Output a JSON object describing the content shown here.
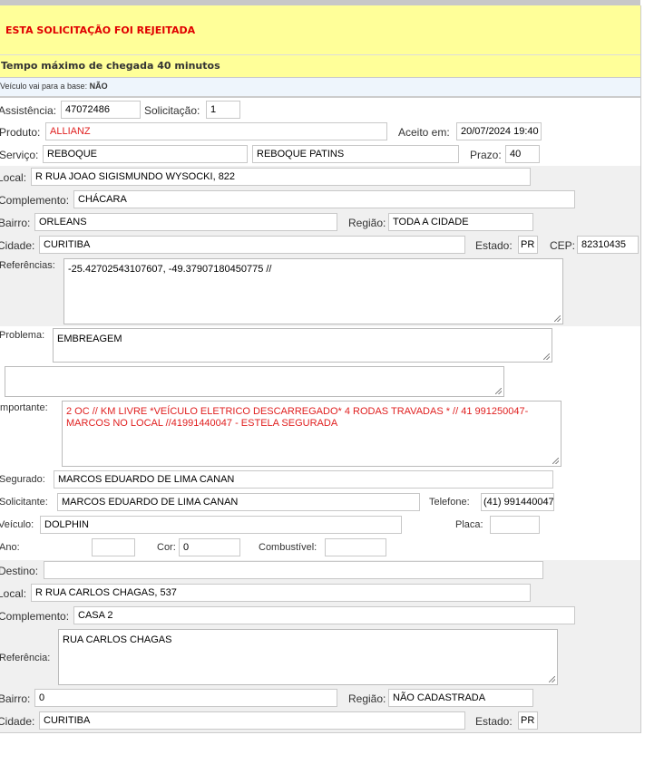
{
  "banner": {
    "rejected": "ESTA SOLICITAÇÃO FOI REJEITADA",
    "max_time": "Tempo máximo de chegada 40 minutos",
    "base_label": "Veículo vai para a base:",
    "base_value": "NÃO"
  },
  "colors": {
    "alert_text": "#e00000",
    "banner_bg": "#ffff99",
    "info_bg": "#eef5fc",
    "section_bg": "#f0f0f0"
  },
  "form": {
    "assistencia": {
      "label": "Assistência:",
      "value": "47072486"
    },
    "solicitacao": {
      "label": "Solicitação:",
      "value": "1"
    },
    "produto": {
      "label": "Produto:",
      "value": "ALLIANZ"
    },
    "aceito": {
      "label": "Aceito em:",
      "value": "20/07/2024 19:40"
    },
    "servico": {
      "label": "Serviço:",
      "value": "REBOQUE",
      "value2": "REBOQUE PATINS"
    },
    "prazo": {
      "label": "Prazo:",
      "value": "40"
    },
    "local": {
      "label": "Local:",
      "value": "R RUA JOAO SIGISMUNDO WYSOCKI, 822"
    },
    "complemento": {
      "label": "Complemento:",
      "value": "CHÁCARA"
    },
    "bairro": {
      "label": "Bairro:",
      "value": "ORLEANS"
    },
    "regiao": {
      "label": "Região:",
      "value": "TODA A CIDADE"
    },
    "cidade": {
      "label": "Cidade:",
      "value": "CURITIBA"
    },
    "estado": {
      "label": "Estado:",
      "value": "PR"
    },
    "cep": {
      "label": "CEP:",
      "value": "82310435"
    },
    "referencias": {
      "label": "Referências:",
      "value": "-25.42702543107607, -49.37907180450775 //"
    },
    "problema": {
      "label": "Problema:",
      "value": "EMBREAGEM"
    },
    "extra": {
      "value": ""
    },
    "importante": {
      "label": "Importante:",
      "value": "2 OC // KM LIVRE *VEÍCULO ELETRICO DESCARREGADO* 4 RODAS TRAVADAS *  // 41 991250047- MARCOS NO LOCAL //41991440047 -  ESTELA  SEGURADA"
    },
    "segurado": {
      "label": "Segurado:",
      "value": "MARCOS EDUARDO DE LIMA CANAN"
    },
    "solicitante": {
      "label": "Solicitante:",
      "value": "MARCOS EDUARDO DE LIMA CANAN"
    },
    "telefone": {
      "label": "Telefone:",
      "value": "(41) 991440047"
    },
    "veiculo": {
      "label": "Veículo:",
      "value": "DOLPHIN"
    },
    "placa": {
      "label": "Placa:",
      "value": ""
    },
    "ano": {
      "label": "Ano:",
      "value": ""
    },
    "cor": {
      "label": "Cor:",
      "value": "0"
    },
    "combustivel": {
      "label": "Combustível:",
      "value": ""
    }
  },
  "destino": {
    "destino": {
      "label": "Destino:",
      "value": ""
    },
    "local": {
      "label": "Local:",
      "value": "R RUA CARLOS CHAGAS, 537"
    },
    "complemento": {
      "label": "Complemento:",
      "value": "CASA 2"
    },
    "referencia": {
      "label": "Referência:",
      "value": "RUA CARLOS CHAGAS"
    },
    "bairro": {
      "label": "Bairro:",
      "value": "0"
    },
    "regiao": {
      "label": "Região:",
      "value": "NÃO CADASTRADA"
    },
    "cidade": {
      "label": "Cidade:",
      "value": "CURITIBA"
    },
    "estado": {
      "label": "Estado:",
      "value": "PR"
    }
  }
}
